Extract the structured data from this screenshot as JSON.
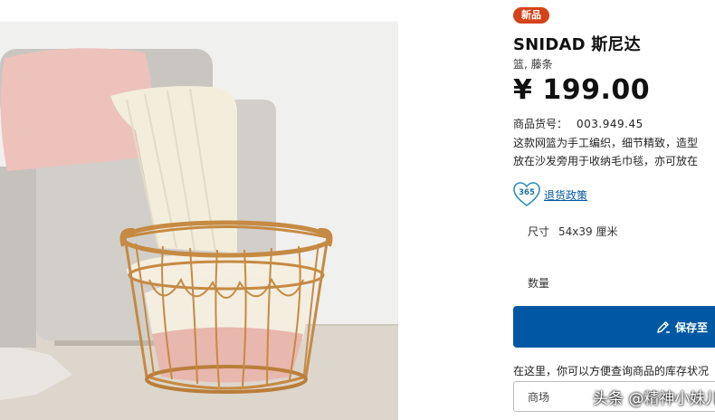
{
  "product": {
    "badge": "新品",
    "name": "SNIDAD 斯尼达",
    "subtitle": "篮, 藤条",
    "price": "¥ 199.00",
    "sku_label": "商品货号：",
    "sku_value": "003.949.45",
    "description_lines": [
      "这款网篮为手工编织，细节精致，造型",
      "放在沙发旁用于收纳毛巾毯，亦可放在"
    ],
    "returns_badge": "365",
    "returns_link": "退货政策",
    "size_label": "尺寸",
    "size_value": "54x39 厘米",
    "quantity_label": "数量",
    "save_button": "保存至",
    "stock_note": "在这里，你可以方便查询商品的库存状况",
    "store_placeholder": "商场"
  },
  "watermark": "头条 @精神小妹儿",
  "colors": {
    "accent_blue": "#0058a3",
    "badge_orange": "#d4431a",
    "returns_teal": "#2a8fbd"
  }
}
